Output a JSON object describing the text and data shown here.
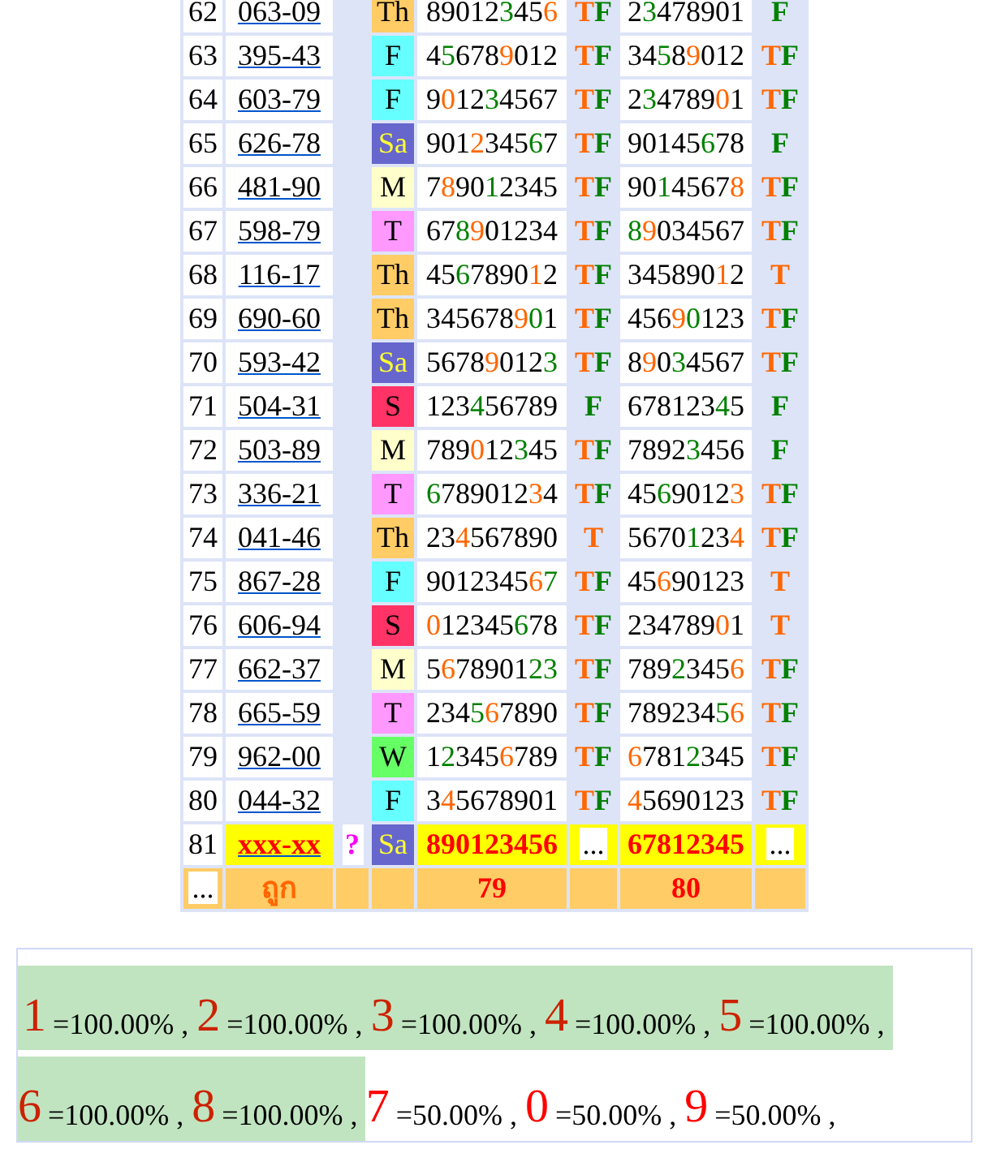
{
  "table": {
    "rows": [
      {
        "kind": "result",
        "number": "62",
        "code": "063-09",
        "day": {
          "text": "Th",
          "color": "#ffcc66"
        },
        "digits_1": [
          {
            "text": "89012",
            "color": "#000000"
          },
          {
            "text": "3",
            "color": "#008000"
          },
          {
            "text": "45",
            "color": "#000000"
          },
          {
            "text": "6",
            "color": "#ff6600"
          }
        ],
        "hit_1": [
          {
            "text": "T",
            "color": "#ff6600"
          },
          {
            "text": "F",
            "color": "#008000"
          }
        ],
        "digits_2": [
          {
            "text": "2",
            "color": "#000000"
          },
          {
            "text": "3",
            "color": "#008000"
          },
          {
            "text": "478901",
            "color": "#000000"
          }
        ],
        "hit_2": [
          {
            "text": "F",
            "color": "#008000"
          }
        ]
      },
      {
        "kind": "result",
        "number": "63",
        "code": "395-43",
        "day": {
          "text": "F",
          "color": "#66ffff"
        },
        "digits_1": [
          {
            "text": "4",
            "color": "#000000"
          },
          {
            "text": "5",
            "color": "#008000"
          },
          {
            "text": "678",
            "color": "#000000"
          },
          {
            "text": "9",
            "color": "#ff6600"
          },
          {
            "text": "012",
            "color": "#000000"
          }
        ],
        "hit_1": [
          {
            "text": "T",
            "color": "#ff6600"
          },
          {
            "text": "F",
            "color": "#008000"
          }
        ],
        "digits_2": [
          {
            "text": "34",
            "color": "#000000"
          },
          {
            "text": "5",
            "color": "#008000"
          },
          {
            "text": "8",
            "color": "#000000"
          },
          {
            "text": "9",
            "color": "#ff6600"
          },
          {
            "text": "012",
            "color": "#000000"
          }
        ],
        "hit_2": [
          {
            "text": "T",
            "color": "#ff6600"
          },
          {
            "text": "F",
            "color": "#008000"
          }
        ]
      },
      {
        "kind": "result",
        "number": "64",
        "code": "603-79",
        "day": {
          "text": "F",
          "color": "#66ffff"
        },
        "digits_1": [
          {
            "text": "9",
            "color": "#000000"
          },
          {
            "text": "0",
            "color": "#ff6600"
          },
          {
            "text": "12",
            "color": "#000000"
          },
          {
            "text": "3",
            "color": "#008000"
          },
          {
            "text": "4567",
            "color": "#000000"
          }
        ],
        "hit_1": [
          {
            "text": "T",
            "color": "#ff6600"
          },
          {
            "text": "F",
            "color": "#008000"
          }
        ],
        "digits_2": [
          {
            "text": "2",
            "color": "#000000"
          },
          {
            "text": "3",
            "color": "#008000"
          },
          {
            "text": "4789",
            "color": "#000000"
          },
          {
            "text": "0",
            "color": "#ff6600"
          },
          {
            "text": "1",
            "color": "#000000"
          }
        ],
        "hit_2": [
          {
            "text": "T",
            "color": "#ff6600"
          },
          {
            "text": "F",
            "color": "#008000"
          }
        ]
      },
      {
        "kind": "result",
        "number": "65",
        "code": "626-78",
        "day": {
          "text": "Sa",
          "color": "#6666cc"
        },
        "digits_1": [
          {
            "text": "901",
            "color": "#000000"
          },
          {
            "text": "2",
            "color": "#ff6600"
          },
          {
            "text": "345",
            "color": "#000000"
          },
          {
            "text": "6",
            "color": "#008000"
          },
          {
            "text": "7",
            "color": "#000000"
          }
        ],
        "hit_1": [
          {
            "text": "T",
            "color": "#ff6600"
          },
          {
            "text": "F",
            "color": "#008000"
          }
        ],
        "digits_2": [
          {
            "text": "90145",
            "color": "#000000"
          },
          {
            "text": "6",
            "color": "#008000"
          },
          {
            "text": "78",
            "color": "#000000"
          }
        ],
        "hit_2": [
          {
            "text": "F",
            "color": "#008000"
          }
        ]
      },
      {
        "kind": "result",
        "number": "66",
        "code": "481-90",
        "day": {
          "text": "M",
          "color": "#ffffcc"
        },
        "digits_1": [
          {
            "text": "7",
            "color": "#000000"
          },
          {
            "text": "8",
            "color": "#ff6600"
          },
          {
            "text": "90",
            "color": "#000000"
          },
          {
            "text": "1",
            "color": "#008000"
          },
          {
            "text": "2345",
            "color": "#000000"
          }
        ],
        "hit_1": [
          {
            "text": "T",
            "color": "#ff6600"
          },
          {
            "text": "F",
            "color": "#008000"
          }
        ],
        "digits_2": [
          {
            "text": "90",
            "color": "#000000"
          },
          {
            "text": "1",
            "color": "#008000"
          },
          {
            "text": "4567",
            "color": "#000000"
          },
          {
            "text": "8",
            "color": "#ff6600"
          }
        ],
        "hit_2": [
          {
            "text": "T",
            "color": "#ff6600"
          },
          {
            "text": "F",
            "color": "#008000"
          }
        ]
      },
      {
        "kind": "result",
        "number": "67",
        "code": "598-79",
        "day": {
          "text": "T",
          "color": "#ff99ff"
        },
        "digits_1": [
          {
            "text": "67",
            "color": "#000000"
          },
          {
            "text": "8",
            "color": "#008000"
          },
          {
            "text": "9",
            "color": "#ff6600"
          },
          {
            "text": "01234",
            "color": "#000000"
          }
        ],
        "hit_1": [
          {
            "text": "T",
            "color": "#ff6600"
          },
          {
            "text": "F",
            "color": "#008000"
          }
        ],
        "digits_2": [
          {
            "text": "8",
            "color": "#008000"
          },
          {
            "text": "9",
            "color": "#ff6600"
          },
          {
            "text": "034567",
            "color": "#000000"
          }
        ],
        "hit_2": [
          {
            "text": "T",
            "color": "#ff6600"
          },
          {
            "text": "F",
            "color": "#008000"
          }
        ]
      },
      {
        "kind": "result",
        "number": "68",
        "code": "116-17",
        "day": {
          "text": "Th",
          "color": "#ffcc66"
        },
        "digits_1": [
          {
            "text": "45",
            "color": "#000000"
          },
          {
            "text": "6",
            "color": "#008000"
          },
          {
            "text": "7890",
            "color": "#000000"
          },
          {
            "text": "1",
            "color": "#ff6600"
          },
          {
            "text": "2",
            "color": "#000000"
          }
        ],
        "hit_1": [
          {
            "text": "T",
            "color": "#ff6600"
          },
          {
            "text": "F",
            "color": "#008000"
          }
        ],
        "digits_2": [
          {
            "text": "345890",
            "color": "#000000"
          },
          {
            "text": "1",
            "color": "#ff6600"
          },
          {
            "text": "2",
            "color": "#000000"
          }
        ],
        "hit_2": [
          {
            "text": "T",
            "color": "#ff6600"
          }
        ]
      },
      {
        "kind": "result",
        "number": "69",
        "code": "690-60",
        "day": {
          "text": "Th",
          "color": "#ffcc66"
        },
        "digits_1": [
          {
            "text": "345678",
            "color": "#000000"
          },
          {
            "text": "9",
            "color": "#ff6600"
          },
          {
            "text": "0",
            "color": "#008000"
          },
          {
            "text": "1",
            "color": "#000000"
          }
        ],
        "hit_1": [
          {
            "text": "T",
            "color": "#ff6600"
          },
          {
            "text": "F",
            "color": "#008000"
          }
        ],
        "digits_2": [
          {
            "text": "456",
            "color": "#000000"
          },
          {
            "text": "9",
            "color": "#ff6600"
          },
          {
            "text": "0",
            "color": "#008000"
          },
          {
            "text": "123",
            "color": "#000000"
          }
        ],
        "hit_2": [
          {
            "text": "T",
            "color": "#ff6600"
          },
          {
            "text": "F",
            "color": "#008000"
          }
        ]
      },
      {
        "kind": "result",
        "number": "70",
        "code": "593-42",
        "day": {
          "text": "Sa",
          "color": "#6666cc"
        },
        "digits_1": [
          {
            "text": "5678",
            "color": "#000000"
          },
          {
            "text": "9",
            "color": "#ff6600"
          },
          {
            "text": "012",
            "color": "#000000"
          },
          {
            "text": "3",
            "color": "#008000"
          }
        ],
        "hit_1": [
          {
            "text": "T",
            "color": "#ff6600"
          },
          {
            "text": "F",
            "color": "#008000"
          }
        ],
        "digits_2": [
          {
            "text": "8",
            "color": "#000000"
          },
          {
            "text": "9",
            "color": "#ff6600"
          },
          {
            "text": "0",
            "color": "#000000"
          },
          {
            "text": "3",
            "color": "#008000"
          },
          {
            "text": "4567",
            "color": "#000000"
          }
        ],
        "hit_2": [
          {
            "text": "T",
            "color": "#ff6600"
          },
          {
            "text": "F",
            "color": "#008000"
          }
        ]
      },
      {
        "kind": "result",
        "number": "71",
        "code": "504-31",
        "day": {
          "text": "S",
          "color": "#ff3366"
        },
        "digits_1": [
          {
            "text": "123",
            "color": "#000000"
          },
          {
            "text": "4",
            "color": "#008000"
          },
          {
            "text": "56789",
            "color": "#000000"
          }
        ],
        "hit_1": [
          {
            "text": "F",
            "color": "#008000"
          }
        ],
        "digits_2": [
          {
            "text": "678123",
            "color": "#000000"
          },
          {
            "text": "4",
            "color": "#008000"
          },
          {
            "text": "5",
            "color": "#000000"
          }
        ],
        "hit_2": [
          {
            "text": "F",
            "color": "#008000"
          }
        ]
      },
      {
        "kind": "result",
        "number": "72",
        "code": "503-89",
        "day": {
          "text": "M",
          "color": "#ffffcc"
        },
        "digits_1": [
          {
            "text": "789",
            "color": "#000000"
          },
          {
            "text": "0",
            "color": "#ff6600"
          },
          {
            "text": "12",
            "color": "#000000"
          },
          {
            "text": "3",
            "color": "#008000"
          },
          {
            "text": "45",
            "color": "#000000"
          }
        ],
        "hit_1": [
          {
            "text": "T",
            "color": "#ff6600"
          },
          {
            "text": "F",
            "color": "#008000"
          }
        ],
        "digits_2": [
          {
            "text": "7892",
            "color": "#000000"
          },
          {
            "text": "3",
            "color": "#008000"
          },
          {
            "text": "456",
            "color": "#000000"
          }
        ],
        "hit_2": [
          {
            "text": "F",
            "color": "#008000"
          }
        ]
      },
      {
        "kind": "result",
        "number": "73",
        "code": "336-21",
        "day": {
          "text": "T",
          "color": "#ff99ff"
        },
        "digits_1": [
          {
            "text": "6",
            "color": "#008000"
          },
          {
            "text": "789012",
            "color": "#000000"
          },
          {
            "text": "3",
            "color": "#ff6600"
          },
          {
            "text": "4",
            "color": "#000000"
          }
        ],
        "hit_1": [
          {
            "text": "T",
            "color": "#ff6600"
          },
          {
            "text": "F",
            "color": "#008000"
          }
        ],
        "digits_2": [
          {
            "text": "45",
            "color": "#000000"
          },
          {
            "text": "6",
            "color": "#008000"
          },
          {
            "text": "9012",
            "color": "#000000"
          },
          {
            "text": "3",
            "color": "#ff6600"
          }
        ],
        "hit_2": [
          {
            "text": "T",
            "color": "#ff6600"
          },
          {
            "text": "F",
            "color": "#008000"
          }
        ]
      },
      {
        "kind": "result",
        "number": "74",
        "code": "041-46",
        "day": {
          "text": "Th",
          "color": "#ffcc66"
        },
        "digits_1": [
          {
            "text": "23",
            "color": "#000000"
          },
          {
            "text": "4",
            "color": "#ff6600"
          },
          {
            "text": "567890",
            "color": "#000000"
          }
        ],
        "hit_1": [
          {
            "text": "T",
            "color": "#ff6600"
          }
        ],
        "digits_2": [
          {
            "text": "5670",
            "color": "#000000"
          },
          {
            "text": "1",
            "color": "#008000"
          },
          {
            "text": "23",
            "color": "#000000"
          },
          {
            "text": "4",
            "color": "#ff6600"
          }
        ],
        "hit_2": [
          {
            "text": "T",
            "color": "#ff6600"
          },
          {
            "text": "F",
            "color": "#008000"
          }
        ]
      },
      {
        "kind": "result",
        "number": "75",
        "code": "867-28",
        "day": {
          "text": "F",
          "color": "#66ffff"
        },
        "digits_1": [
          {
            "text": "9012345",
            "color": "#000000"
          },
          {
            "text": "6",
            "color": "#ff6600"
          },
          {
            "text": "7",
            "color": "#008000"
          }
        ],
        "hit_1": [
          {
            "text": "T",
            "color": "#ff6600"
          },
          {
            "text": "F",
            "color": "#008000"
          }
        ],
        "digits_2": [
          {
            "text": "45",
            "color": "#000000"
          },
          {
            "text": "6",
            "color": "#ff6600"
          },
          {
            "text": "90123",
            "color": "#000000"
          }
        ],
        "hit_2": [
          {
            "text": "T",
            "color": "#ff6600"
          }
        ]
      },
      {
        "kind": "result",
        "number": "76",
        "code": "606-94",
        "day": {
          "text": "S",
          "color": "#ff3366"
        },
        "digits_1": [
          {
            "text": "0",
            "color": "#ff6600"
          },
          {
            "text": "12345",
            "color": "#000000"
          },
          {
            "text": "6",
            "color": "#008000"
          },
          {
            "text": "78",
            "color": "#000000"
          }
        ],
        "hit_1": [
          {
            "text": "T",
            "color": "#ff6600"
          },
          {
            "text": "F",
            "color": "#008000"
          }
        ],
        "digits_2": [
          {
            "text": "234789",
            "color": "#000000"
          },
          {
            "text": "0",
            "color": "#ff6600"
          },
          {
            "text": "1",
            "color": "#000000"
          }
        ],
        "hit_2": [
          {
            "text": "T",
            "color": "#ff6600"
          }
        ]
      },
      {
        "kind": "result",
        "number": "77",
        "code": "662-37",
        "day": {
          "text": "M",
          "color": "#ffffcc"
        },
        "digits_1": [
          {
            "text": "5",
            "color": "#000000"
          },
          {
            "text": "6",
            "color": "#ff6600"
          },
          {
            "text": "78901",
            "color": "#000000"
          },
          {
            "text": "23",
            "color": "#008000"
          }
        ],
        "hit_1": [
          {
            "text": "T",
            "color": "#ff6600"
          },
          {
            "text": "F",
            "color": "#008000"
          }
        ],
        "digits_2": [
          {
            "text": "789",
            "color": "#000000"
          },
          {
            "text": "2",
            "color": "#008000"
          },
          {
            "text": "345",
            "color": "#000000"
          },
          {
            "text": "6",
            "color": "#ff6600"
          }
        ],
        "hit_2": [
          {
            "text": "T",
            "color": "#ff6600"
          },
          {
            "text": "F",
            "color": "#008000"
          }
        ]
      },
      {
        "kind": "result",
        "number": "78",
        "code": "665-59",
        "day": {
          "text": "T",
          "color": "#ff99ff"
        },
        "digits_1": [
          {
            "text": "234",
            "color": "#000000"
          },
          {
            "text": "5",
            "color": "#008000"
          },
          {
            "text": "6",
            "color": "#ff6600"
          },
          {
            "text": "7890",
            "color": "#000000"
          }
        ],
        "hit_1": [
          {
            "text": "T",
            "color": "#ff6600"
          },
          {
            "text": "F",
            "color": "#008000"
          }
        ],
        "digits_2": [
          {
            "text": "78923",
            "color": "#000000"
          },
          {
            "text": "4",
            "color": "#000000"
          },
          {
            "text": "5",
            "color": "#008000"
          },
          {
            "text": "6",
            "color": "#ff6600"
          }
        ],
        "hit_2": [
          {
            "text": "T",
            "color": "#ff6600"
          },
          {
            "text": "F",
            "color": "#008000"
          }
        ]
      },
      {
        "kind": "result",
        "number": "79",
        "code": "962-00",
        "day": {
          "text": "W",
          "color": "#66ff66"
        },
        "digits_1": [
          {
            "text": "1",
            "color": "#000000"
          },
          {
            "text": "2",
            "color": "#008000"
          },
          {
            "text": "345",
            "color": "#000000"
          },
          {
            "text": "6",
            "color": "#ff6600"
          },
          {
            "text": "789",
            "color": "#000000"
          }
        ],
        "hit_1": [
          {
            "text": "T",
            "color": "#ff6600"
          },
          {
            "text": "F",
            "color": "#008000"
          }
        ],
        "digits_2": [
          {
            "text": "6",
            "color": "#ff6600"
          },
          {
            "text": "781",
            "color": "#000000"
          },
          {
            "text": "2",
            "color": "#008000"
          },
          {
            "text": "345",
            "color": "#000000"
          }
        ],
        "hit_2": [
          {
            "text": "T",
            "color": "#ff6600"
          },
          {
            "text": "F",
            "color": "#008000"
          }
        ]
      },
      {
        "kind": "result",
        "number": "80",
        "code": "044-32",
        "day": {
          "text": "F",
          "color": "#66ffff"
        },
        "digits_1": [
          {
            "text": "3",
            "color": "#000000"
          },
          {
            "text": "4",
            "color": "#ff6600"
          },
          {
            "text": "5678901",
            "color": "#000000"
          }
        ],
        "hit_1": [
          {
            "text": "T",
            "color": "#ff6600"
          },
          {
            "text": "F",
            "color": "#008000"
          }
        ],
        "digits_2": [
          {
            "text": "4",
            "color": "#ff6600"
          },
          {
            "text": "5690123",
            "color": "#000000"
          }
        ],
        "hit_2": [
          {
            "text": "T",
            "color": "#ff6600"
          },
          {
            "text": "F",
            "color": "#008000"
          }
        ]
      },
      {
        "kind": "pending",
        "number": "81",
        "code": "xxx-xx",
        "mark": "?",
        "day": {
          "text": "Sa",
          "color": "#6666cc"
        },
        "digits_1": [
          {
            "text": "890123456",
            "color": "#ff0000"
          }
        ],
        "hit_1": [
          {
            "text": "...",
            "color": "#000000"
          }
        ],
        "digits_2": [
          {
            "text": "67812345",
            "color": "#ff0000"
          }
        ],
        "hit_2": [
          {
            "text": "...",
            "color": "#000000"
          }
        ]
      },
      {
        "kind": "summary",
        "number": "...",
        "code": "ถูก",
        "count_1": "79",
        "count_2": "80"
      }
    ]
  },
  "stats": [
    {
      "digit": "1",
      "rate": "=100.00% ,",
      "highlighted": true
    },
    {
      "digit": "2",
      "rate": "=100.00% ,",
      "highlighted": true
    },
    {
      "digit": "3",
      "rate": "=100.00% ,",
      "highlighted": true
    },
    {
      "digit": "4",
      "rate": "=100.00% ,",
      "highlighted": true
    },
    {
      "digit": "5",
      "rate": "=100.00% ,",
      "highlighted": true
    },
    {
      "digit": "6",
      "rate": "=100.00% ,",
      "highlighted": true
    },
    {
      "digit": "8",
      "rate": "=100.00% ,",
      "highlighted": true
    },
    {
      "digit": "7",
      "rate": "=50.00% ,",
      "highlighted": false
    },
    {
      "digit": "0",
      "rate": "=50.00% ,",
      "highlighted": false
    },
    {
      "digit": "9",
      "rate": "=50.00% ,",
      "highlighted": false
    }
  ]
}
